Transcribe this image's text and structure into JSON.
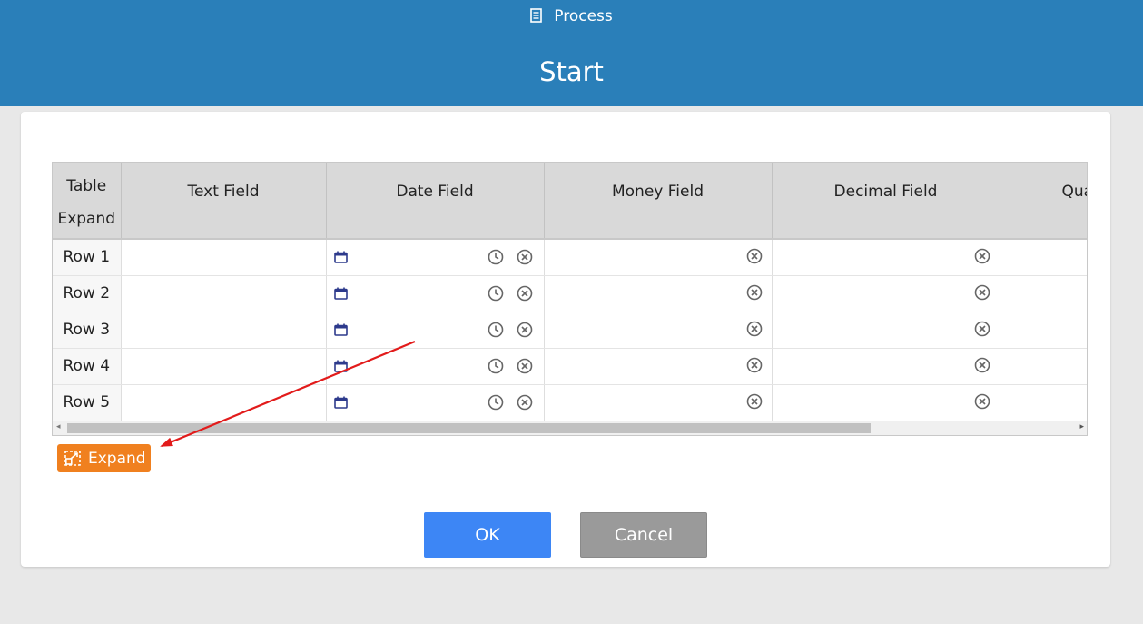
{
  "header": {
    "process_label": "Process",
    "title": "Start"
  },
  "table": {
    "columns": [
      "Table Expand",
      "Text Field",
      "Date Field",
      "Money Field",
      "Decimal Field",
      "Qua"
    ],
    "rows": [
      "Row 1",
      "Row 2",
      "Row 3",
      "Row 4",
      "Row 5"
    ]
  },
  "expand_label": "Expand",
  "ok_label": "OK",
  "cancel_label": "Cancel",
  "colors": {
    "header": "#2a7fb9",
    "expand": "#f0801f",
    "ok": "#3d86f5",
    "cancel": "#9a9a9a",
    "annotation": "#e21b1b"
  },
  "icons": [
    "document-icon",
    "calendar-icon",
    "clock-icon",
    "clear-icon",
    "expand-icon"
  ]
}
